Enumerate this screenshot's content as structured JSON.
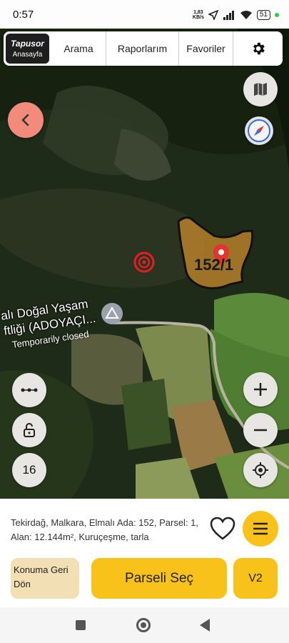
{
  "status_bar": {
    "time": "0:57",
    "net_speed_value": "1,83",
    "net_speed_unit": "KB/s",
    "battery": "51"
  },
  "top_nav": {
    "brand_name": "Tapusor",
    "brand_sub": "Anasayfa",
    "items": [
      "Arama",
      "Raporlarım",
      "Favoriler"
    ],
    "settings_icon": "gear-icon"
  },
  "map": {
    "place_label_line1": "alı Doğal Yaşam",
    "place_label_line2": "ftliği (ADOYAÇI...",
    "place_label_status": "Temporarily closed",
    "parcel_label": "152/1",
    "zoom_level": "16",
    "colors": {
      "parcel_fill": "#b5802a",
      "parcel_stroke": "#111111",
      "pin": "#e3342f",
      "target": "#e31e24"
    }
  },
  "info": {
    "description": "Tekirdağ, Malkara, Elmalı Ada: 152, Parsel: 1, Alan: 12.144m², Kuruçeşme, tarla"
  },
  "actions": {
    "konum_label": "Konuma Geri Dön",
    "select_label": "Parseli Seç",
    "v2_label": "V2"
  }
}
